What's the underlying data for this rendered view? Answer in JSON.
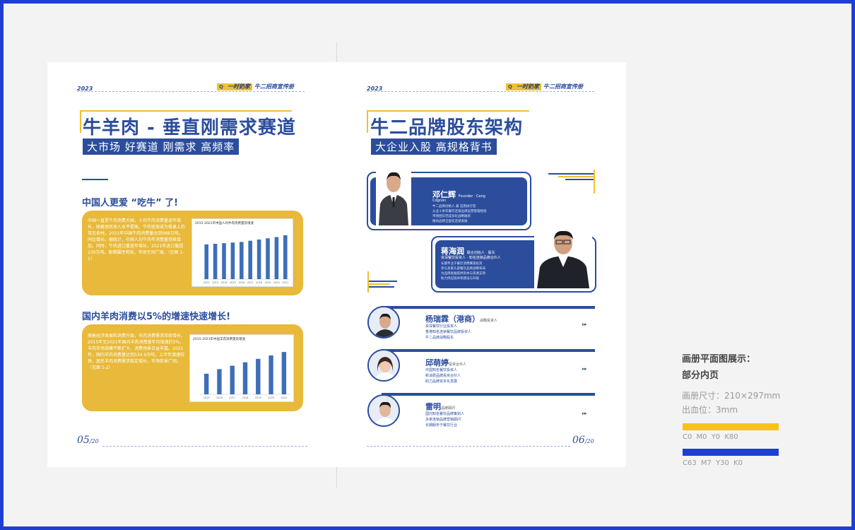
{
  "left_page": {
    "year": "2023",
    "tag_search": "Q",
    "tag_primary": "一时奶家",
    "tag_secondary": "牛二招商宣传册",
    "title": "牛羊肉 - 垂直刚需求赛道",
    "subtitle": "大市场 好赛道 刚需求 高频率",
    "section1": {
      "heading": "中国人更爱 “吃牛” 了!",
      "body": "中国一直是牛肉消费大国，人均牛肉消费量逐年增长，随着居民收入水平提高，牛肉逐渐成为餐桌上的常见食材。2021年中国牛肉消费量达到988万吨，同比增长。据统计，中国人均牛肉年消费量持续增加。同时，牛肉进口量逐年增长，2021年进口量超230万吨，刚需属性明显，市场空间广阔。（见图 1-1）",
      "chart_title": "2015-2021年中国人均牛肉消费量及增速"
    },
    "section2": {
      "heading": "国内羊肉消费以5%的增速快速增长!",
      "body": "随着经济发展和消费升级，羊肉消费需求持续增长，2015年至2021年国内羊肉消费量年均增速约5%，羊肉市场规模不断扩大，消费场景日益丰富。2021年，国内羊肉消费量达到534.9万吨，上半年增速较快，居民羊肉消费需求稳定增长，市场前景广阔。（见图 1-2）",
      "chart_title": "2015-2021年中国羊肉消费量及增速"
    },
    "page_number": "05",
    "page_total": "/20"
  },
  "right_page": {
    "year": "2023",
    "tag_search": "Q",
    "tag_primary": "一时奶家",
    "tag_secondary": "牛二招商宣传册",
    "title": "牛二品牌股东架构",
    "subtitle": "大企业入股 高规格背书",
    "holder1": {
      "name": "邓仁辉",
      "name_en": "Founder · Ceng",
      "role": "Cdgnon",
      "desc": "牛二品牌创始人 兼 首席执行官\n从业十余年餐饮连锁品牌运营管理经验\n带领团队完成多轮战略融资\n推动品牌全国化连锁发展"
    },
    "holder2": {
      "name": "蒋海润",
      "name_en": "联合创始人 · 股东",
      "role": "资深餐饮投资人 · 知名连锁品牌合伙人",
      "desc": "长期专注于餐饮消费赛道投资\n参与多家头部餐饮品牌战略布局\n为品牌发展提供资本与资源支持\n助力供应链体系建设与升级"
    }
  },
  "right_rows": [
    {
      "name": "杨瑞霖（港商）",
      "tag": "战略投资人",
      "desc": "资深餐饮行业投资人\n香港知名连锁餐饮品牌投资人\n牛二品牌战略股东"
    },
    {
      "name": "邱萌婷",
      "tag": "投资合伙人",
      "desc": "中国知名餐饮投资人\n新消费品牌投资合伙人\n助力品牌资本化发展"
    },
    {
      "name": "雷明",
      "tag": "品牌顾问",
      "desc": "国内知名餐饮品牌策划人\n多家连锁品牌营销顾问\n长期服务于餐饮行业"
    }
  ],
  "right_page_number": "06",
  "right_page_total": "/20",
  "caption": {
    "line1": "画册平面图展示：",
    "line2": "部分内页",
    "size": "画册尺寸：210×297mm",
    "bleed": "出血位：3mm"
  },
  "swatches": [
    {
      "color": "#f7c21c",
      "label": "C0  M0  Y0  K80"
    },
    {
      "color": "#1f3fd0",
      "label": "C63  M7  Y30  K0"
    }
  ],
  "chart_data": [
    {
      "type": "bar",
      "title": "2015-2021年中国人均牛肉消费量及增速",
      "categories": [
        "2012",
        "2013",
        "2014",
        "2015",
        "2016",
        "2017",
        "2018",
        "2019",
        "2020",
        "2021"
      ],
      "values": [
        5.7,
        5.8,
        5.9,
        6.0,
        6.1,
        6.3,
        6.5,
        6.7,
        6.9,
        7.2
      ],
      "ylim": [
        0,
        8
      ]
    },
    {
      "type": "bar",
      "title": "2015-2021年中国羊肉消费量及增速",
      "categories": [
        "2015",
        "2016",
        "2017",
        "2018",
        "2019",
        "2020",
        "2021"
      ],
      "values": [
        440,
        460,
        475,
        490,
        505,
        520,
        535
      ],
      "ylim": [
        350,
        560
      ]
    }
  ],
  "colors": {
    "brand_blue": "#2b4d9c",
    "brand_yellow": "#e8b93a",
    "frame_blue": "#1f3fd0"
  }
}
